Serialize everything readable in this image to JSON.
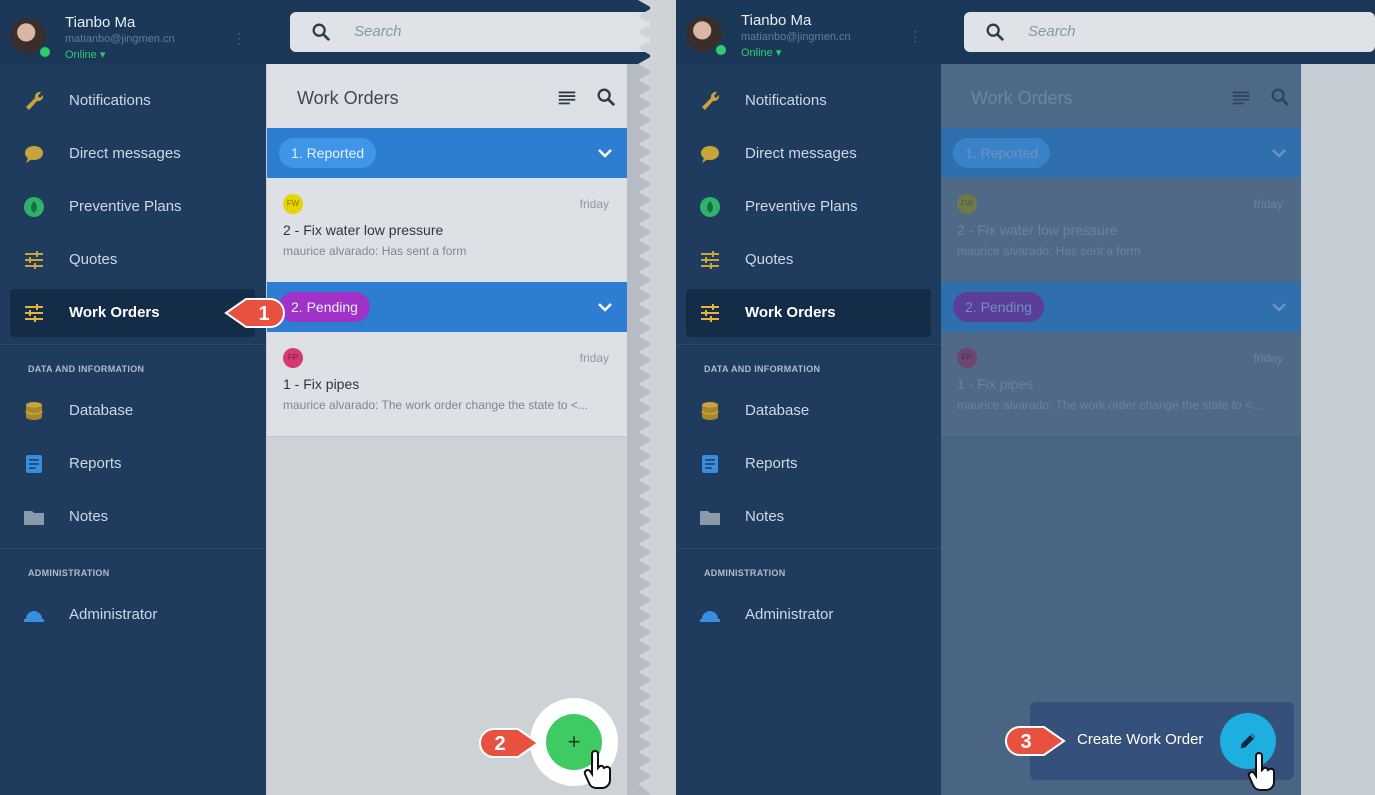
{
  "user": {
    "name": "Tianbo Ma",
    "email": "matianbo@jingmen.cn",
    "status": "Online"
  },
  "search": {
    "placeholder": "Search"
  },
  "nav": {
    "items": [
      {
        "label": "Notifications",
        "icon": "wrench-icon"
      },
      {
        "label": "Direct messages",
        "icon": "chat-bubble-icon"
      },
      {
        "label": "Preventive Plans",
        "icon": "leaf-circle-icon"
      },
      {
        "label": "Quotes",
        "icon": "sliders-icon"
      },
      {
        "label": "Work Orders",
        "icon": "sliders-icon",
        "active": true
      }
    ],
    "section_data": "DATA AND INFORMATION",
    "data_items": [
      {
        "label": "Database",
        "icon": "database-icon"
      },
      {
        "label": "Reports",
        "icon": "document-icon"
      },
      {
        "label": "Notes",
        "icon": "folder-icon"
      }
    ],
    "section_admin": "ADMINISTRATION",
    "admin_items": [
      {
        "label": "Administrator",
        "icon": "hard-hat-icon"
      }
    ]
  },
  "work_orders": {
    "title": "Work Orders",
    "groups": [
      {
        "label": "1. Reported",
        "color": "#3f95e8",
        "cards": [
          {
            "badge": "FW",
            "badge_color": "#e6d400",
            "date": "friday",
            "title": "2 - Fix water low pressure",
            "sub": "maurice alvarado: Has sent a form"
          }
        ]
      },
      {
        "label": "2. Pending",
        "color": "#a032c8",
        "cards": [
          {
            "badge": "FP",
            "badge_color": "#d6396f",
            "date": "friday",
            "title": "1 - Fix pipes",
            "sub": "maurice alvarado: The work order change the state to <..."
          }
        ]
      }
    ]
  },
  "callouts": {
    "step1": "1",
    "step2": "2",
    "step3": "3"
  },
  "fab": {
    "add_symbol": "+",
    "create_label": "Create Work Order"
  },
  "colors": {
    "sidebar": "#1f3c5f",
    "callout": "#e8503f",
    "fab_green": "#3ecb64",
    "fab_blue": "#1eaedf",
    "online": "#2ecc71"
  }
}
